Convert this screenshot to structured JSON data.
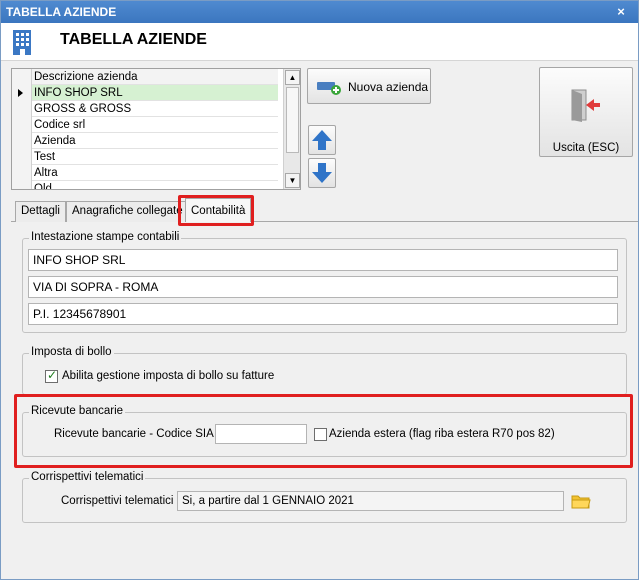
{
  "window": {
    "title": "TABELLA AZIENDE",
    "close_glyph": "×"
  },
  "header": {
    "title": "TABELLA AZIENDE",
    "icon": "building-icon"
  },
  "grid": {
    "column_header": "Descrizione azienda",
    "rows": [
      "INFO SHOP SRL",
      "GROSS & GROSS",
      "Codice srl",
      "Azienda",
      "Test",
      "Altra",
      "Old"
    ],
    "selected_index": 0
  },
  "buttons": {
    "new_company": "Nuova azienda",
    "exit": "Uscita (ESC)"
  },
  "tabs": [
    "Dettagli",
    "Anagrafiche collegate",
    "Contabilità"
  ],
  "active_tab": "Contabilità",
  "intestazione": {
    "title": "Intestazione stampe contabili",
    "line1": "INFO SHOP SRL",
    "line2": "VIA DI SOPRA - ROMA",
    "line3": "P.I. 12345678901"
  },
  "bollo": {
    "title": "Imposta di bollo",
    "checkbox_label": "Abilita gestione imposta di bollo su fatture",
    "checked": true
  },
  "ricevute": {
    "title": "Ricevute bancarie",
    "sia_label": "Ricevute bancarie - Codice SIA :",
    "sia_value": "",
    "foreign_label": "Azienda estera (flag riba estera R70 pos 82)",
    "foreign_checked": false
  },
  "corrispettivi": {
    "title": "Corrispettivi telematici",
    "label": "Corrispettivi telematici :",
    "value": "Si, a partire dal 1 GENNAIO 2021"
  },
  "colors": {
    "highlight_red": "#e01f1f",
    "selected_row": "#d6f1d2",
    "title_blue": "#3b76bf"
  }
}
